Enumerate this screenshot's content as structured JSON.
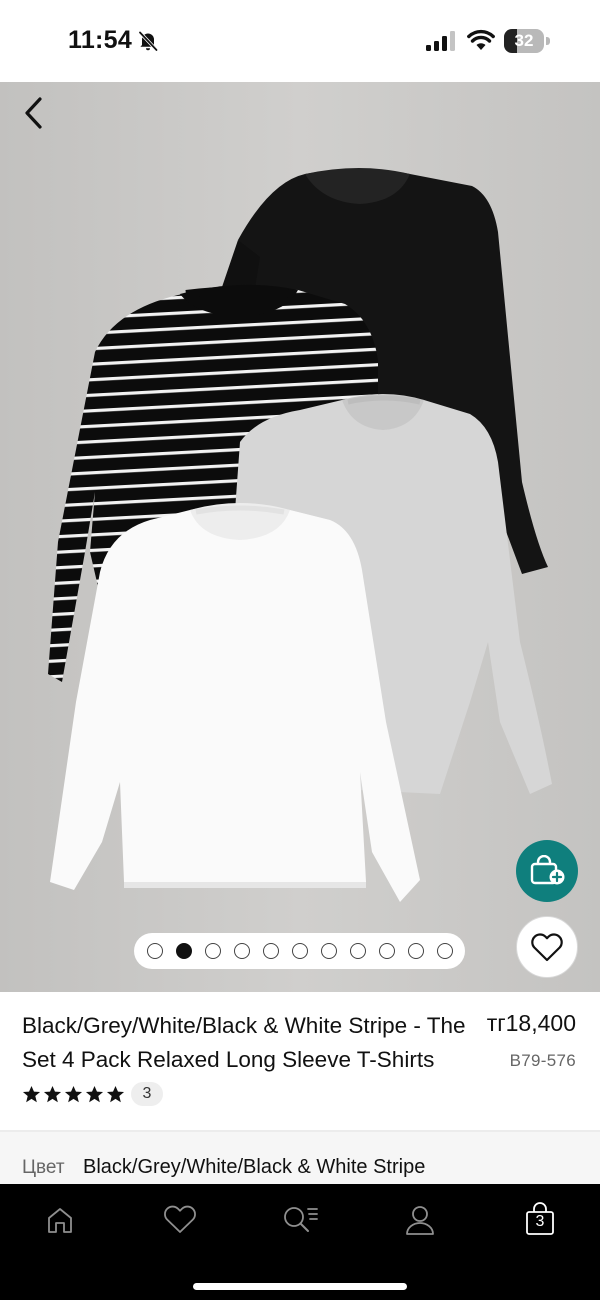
{
  "status_bar": {
    "time": "11:54",
    "battery_percent": 32,
    "battery_label": "32",
    "icons": [
      "bell-slash-icon",
      "signal-icon",
      "wifi-icon",
      "battery-icon"
    ]
  },
  "gallery": {
    "page_count": 11,
    "current_page": 2,
    "accent_color": "#0f7f7d",
    "image_alt": "Black/Grey/White/Black & White Stripe long sleeve t-shirts"
  },
  "product": {
    "title": "Black/Grey/White/Black & White Stripe - The Set 4 Pack Relaxed Long Sleeve T-Shirts",
    "price": "тг18,400",
    "code": "B79-576",
    "rating_stars": 5,
    "review_count": "3"
  },
  "color": {
    "label": "Цвет",
    "value": "Black/Grey/White/Black & White Stripe"
  },
  "tab_bar": {
    "items": [
      "home-icon",
      "heart-icon",
      "search-list-icon",
      "profile-icon",
      "bag-icon"
    ],
    "bag_count": "3"
  }
}
